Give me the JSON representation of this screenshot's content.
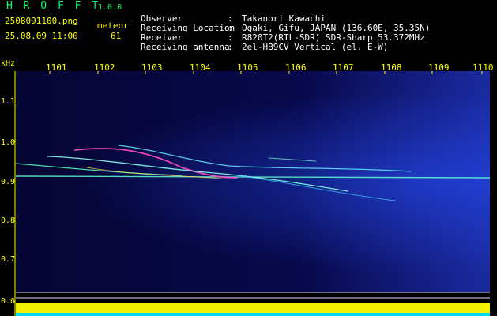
{
  "app": {
    "title": "H R O F F T",
    "version": "1.0.0"
  },
  "file": {
    "name": "2508091100.png",
    "datetime": "25.08.09 11:00"
  },
  "meteor": {
    "label": "meteor",
    "count": "61"
  },
  "info": [
    {
      "key": "Observer",
      "value": "Takanori Kawachi"
    },
    {
      "key": "Receiving Location",
      "value": "Ogaki, Gifu, JAPAN (136.60E, 35.35N)"
    },
    {
      "key": "Receiver",
      "value": "R820T2(RTL-SDR) SDR-Sharp 53.372MHz"
    },
    {
      "key": "Receiving antenna",
      "value": "2el-HB9CV Vertical (el. E-W)"
    }
  ],
  "axis": {
    "unit": "kHz",
    "time_ticks": [
      "1101",
      "1102",
      "1103",
      "1104",
      "1105",
      "1106",
      "1107",
      "1108",
      "1109",
      "1110"
    ],
    "freq_ticks": [
      "1.1",
      "1.0",
      "0.9",
      "0.8",
      "0.7",
      "0.6"
    ]
  },
  "colors": {
    "header_green": "#00ff66",
    "text_yellow": "#ffff00",
    "bg": "#000000"
  }
}
